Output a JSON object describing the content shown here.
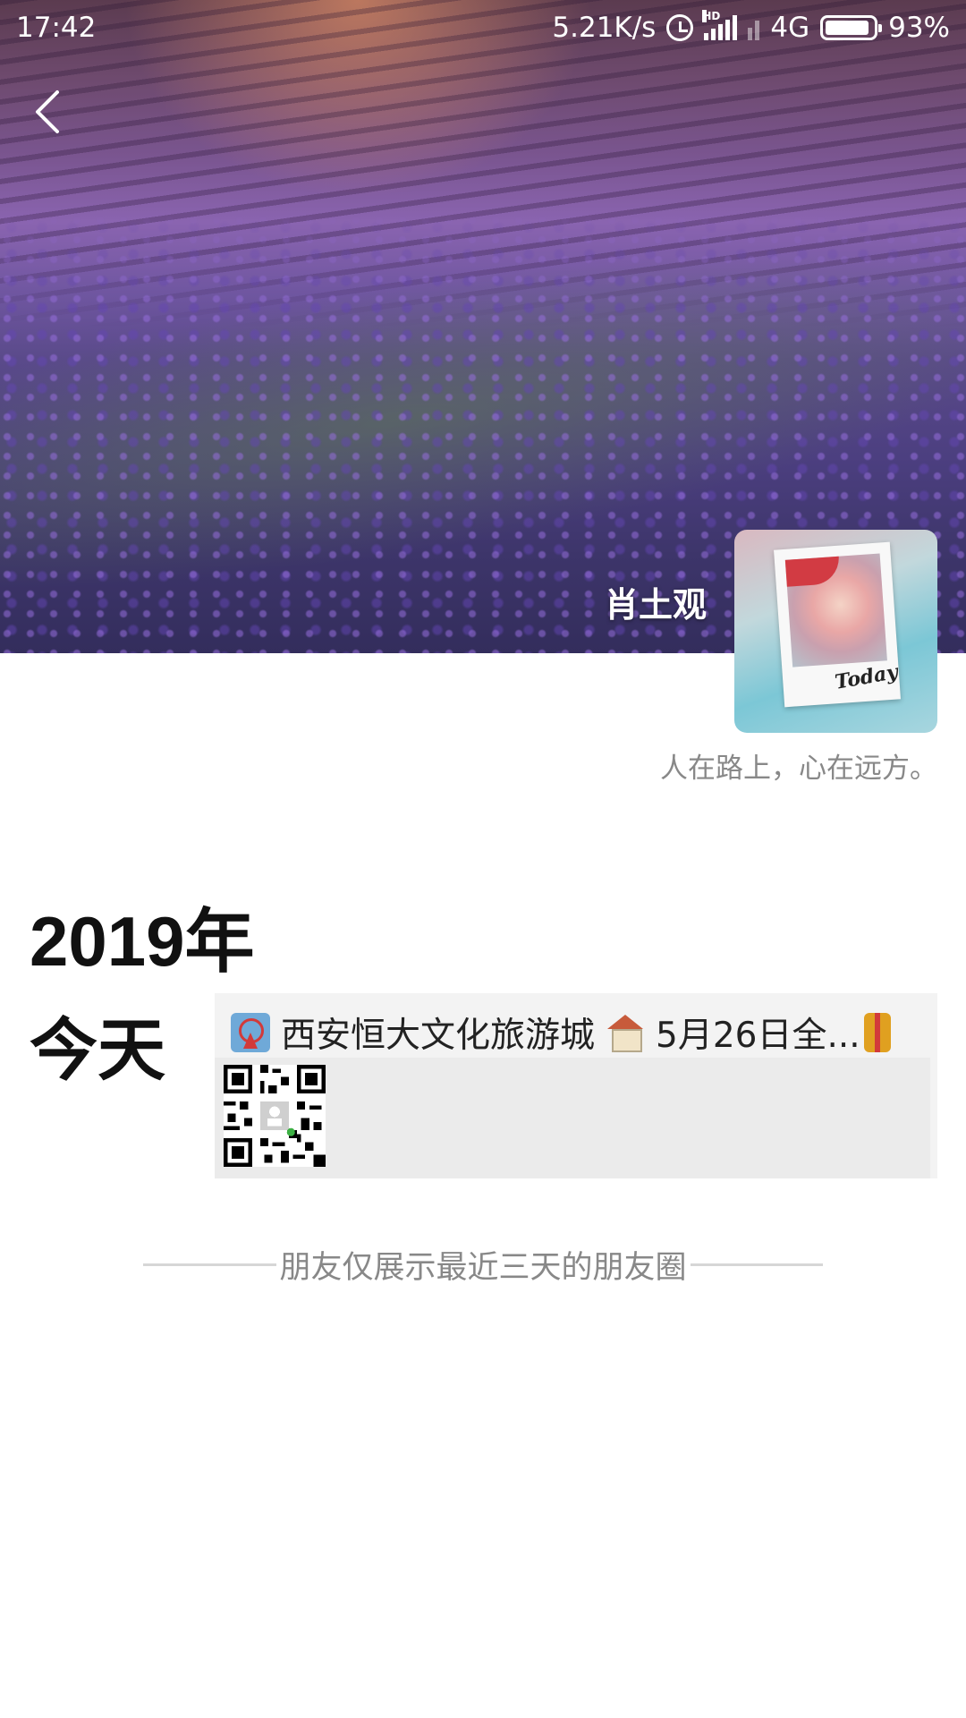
{
  "status_bar": {
    "time": "17:42",
    "network_speed": "5.21K/s",
    "signal_label": "HD",
    "network_type": "4G",
    "battery": "93%",
    "battery_level": 0.93
  },
  "header": {
    "back_icon": "chevron-left-icon"
  },
  "profile": {
    "nickname": "肖土观",
    "avatar_caption": "Today",
    "signature": "人在路上，心在远方。"
  },
  "timeline": {
    "year": "2019年",
    "posts": [
      {
        "day_label": "今天",
        "text_before": "西安恒大文化旅游城",
        "text_after": "5月26日全...",
        "emojis": [
          "ferris-wheel-icon",
          "house-icon",
          "gift-icon"
        ],
        "media": "qr-code-image"
      }
    ]
  },
  "footer": {
    "note": "朋友仅展示最近三天的朋友圈"
  }
}
